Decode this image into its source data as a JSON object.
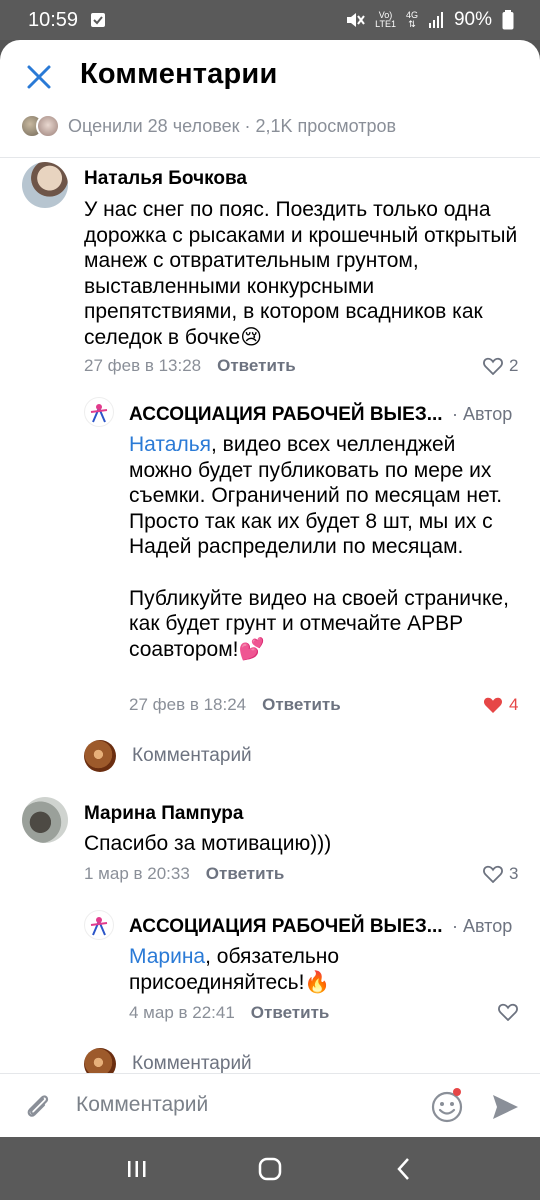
{
  "status": {
    "time": "10:59",
    "volte_top": "Vo)",
    "volte_bottom": "LTE1",
    "network_top": "4G",
    "battery": "90%"
  },
  "header": {
    "title": "Комментарии",
    "likes_text": "Оценили 28 человек · 2,1K просмотров"
  },
  "comments": [
    {
      "author": "Наталья Бочкова",
      "text": "У нас снег по пояс. Поездить только одна дорожка с рысаками и крошечный открытый манеж с отвратительным грунтом, выставленными конкурсными препятствиями, в котором всадников как селедок в бочке😢",
      "time": "27 фев в 13:28",
      "reply_label": "Ответить",
      "likes": "2"
    },
    {
      "author": "АССОЦИАЦИЯ РАБОЧЕЙ ВЫЕЗ...",
      "author_tag": "· Автор",
      "mention": "Наталья",
      "text": ", видео всех челленджей можно будет публиковать по мере их съемки. Ограничений по месяцам нет.",
      "text2": "Просто так как их будет 8 шт, мы их с Надей распределили по месяцам.",
      "text3": "Публикуйте видео на своей страничке, как будет грунт и отмечайте АРВР соавтором!💕",
      "time": "27 фев в 18:24",
      "reply_label": "Ответить",
      "likes": "4"
    },
    {
      "author": "Марина Пампура",
      "text": "Спасибо за мотивацию)))",
      "time": "1 мар в 20:33",
      "reply_label": "Ответить",
      "likes": "3"
    },
    {
      "author": "АССОЦИАЦИЯ РАБОЧЕЙ ВЫЕЗ...",
      "author_tag": "· Автор",
      "mention": "Марина",
      "text": ", обязательно присоединяйтесь!🔥",
      "time": "4 мар в 22:41",
      "reply_label": "Ответить"
    }
  ],
  "reply_prompt": "Комментарий",
  "input": {
    "placeholder": "Комментарий"
  },
  "colors": {
    "accent": "#2a7ad6",
    "like_active": "#e64646",
    "secondary_text": "#8a8f98"
  }
}
